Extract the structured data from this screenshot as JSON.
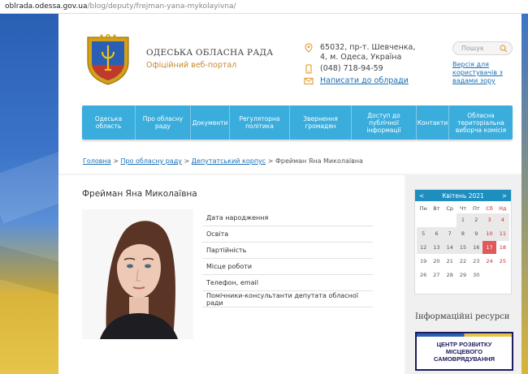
{
  "browser": {
    "url_host": "oblrada.odessa.gov.ua",
    "url_path": "/blog/deputy/frejman-yana-mykolayivna/"
  },
  "header": {
    "title": "ОДЕСЬКА ОБЛАСНА РАДА",
    "subtitle": "Офіційний веб-портал",
    "address_line1": "65032, пр-т. Шевченка,",
    "address_line2": "4, м. Одеса, Україна",
    "phone": "(048) 718-94-59",
    "mail_link": "Написати до облради",
    "search_placeholder": "Пошук",
    "a11y_link": "Версія для користувачів з вадами зору"
  },
  "nav": {
    "items": [
      "Одеська область",
      "Про обласну раду",
      "Документи",
      "Регуляторна політика",
      "Звернення громадян",
      "Доступ до публічної інформації",
      "Контакти",
      "Обласна територіальна виборча комісія"
    ]
  },
  "breadcrumb": {
    "home": "Головна",
    "sep": ">",
    "about": "Про обласну раду",
    "corps": "Депутатський корпус",
    "current": "Фрейман Яна Миколаївна"
  },
  "main": {
    "title": "Фрейман Яна Миколаївна",
    "fields": [
      "Дата народження",
      "Освіта",
      "Партійність",
      "Місце роботи",
      "Телефон, email",
      "Помічники-консультанти депутата обласної ради"
    ]
  },
  "calendar": {
    "prev": "<",
    "next": ">",
    "month": "Квітень 2021",
    "weekdays": [
      "Пн",
      "Вт",
      "Ср",
      "Чт",
      "Пт",
      "Сб",
      "Нд"
    ],
    "days": [
      "",
      "",
      "",
      "1",
      "2",
      "3",
      "4",
      "5",
      "6",
      "7",
      "8",
      "9",
      "10",
      "11",
      "12",
      "13",
      "14",
      "15",
      "16",
      "17",
      "18",
      "19",
      "20",
      "21",
      "22",
      "23",
      "24",
      "25",
      "26",
      "27",
      "28",
      "29",
      "30",
      "",
      ""
    ],
    "today": "17"
  },
  "sidebar": {
    "resources_title": "Інформаційні ресурси",
    "banner_line1": "ЦЕНТР РОЗВИТКУ",
    "banner_line2": "МІСЦЕВОГО САМОВРЯДУВАННЯ"
  },
  "colors": {
    "nav_bg": "#3aaddc",
    "link": "#1e6fb3",
    "accent_orange": "#c58a2e",
    "today": "#e05a5a"
  },
  "icons": {
    "address": "map-pin-icon",
    "phone": "phone-icon",
    "mail": "envelope-icon",
    "search": "search-icon",
    "logo": "coat-of-arms"
  }
}
